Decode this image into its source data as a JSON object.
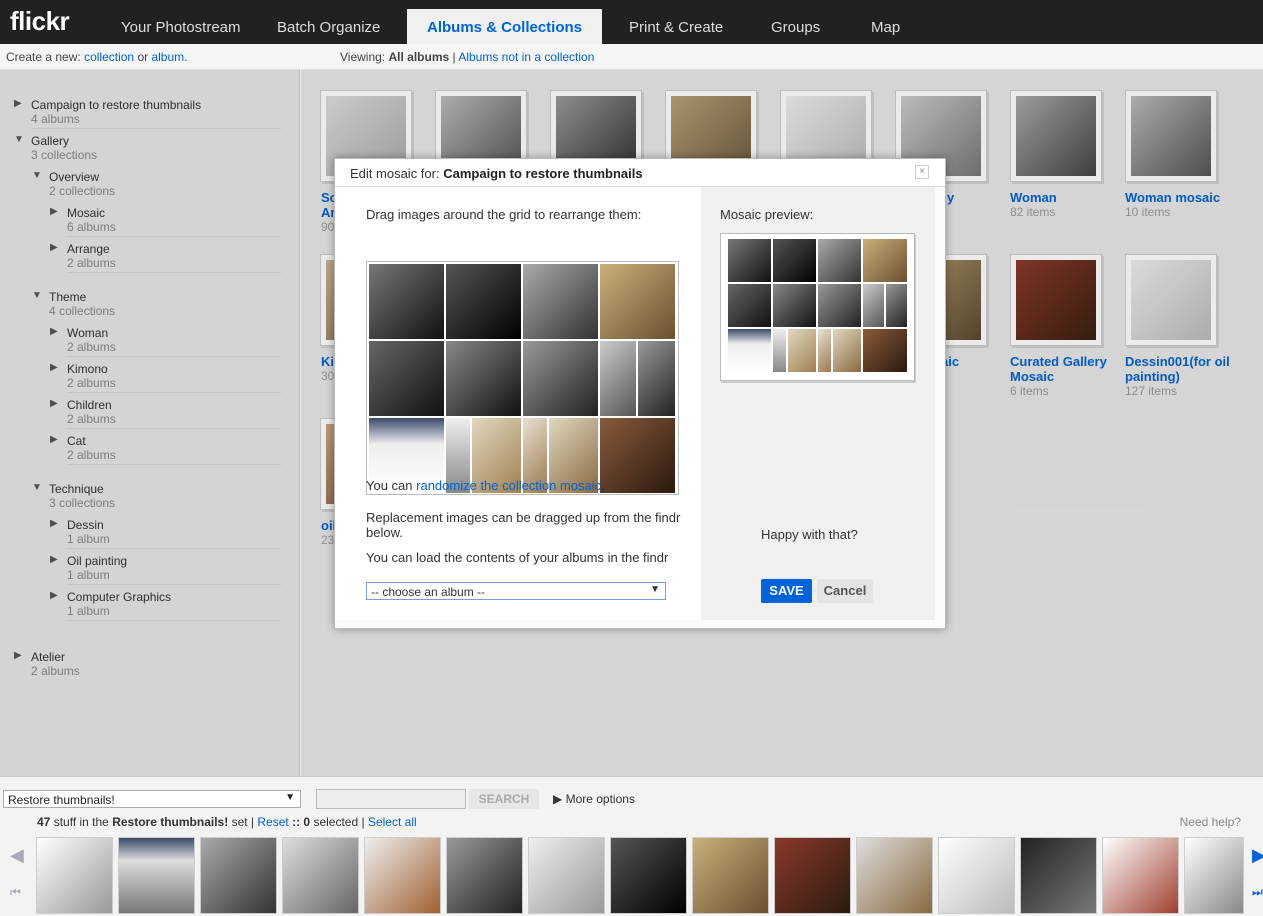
{
  "app": {
    "logo": "flickr",
    "nav": [
      "Your Photostream",
      "Batch Organize",
      "Albums & Collections",
      "Print & Create",
      "Groups",
      "Map"
    ],
    "active_nav": "Albums & Collections"
  },
  "subbar": {
    "create_prefix": "Create a new:",
    "collection_link": "collection",
    "or": "or",
    "album_link": "album",
    "period": ".",
    "viewing_prefix": "Viewing:",
    "viewing_current": "All albums",
    "separator": "|",
    "viewing_other": "Albums not in a collection"
  },
  "sidebar": {
    "items": [
      {
        "title": "Campaign to restore thumbnails",
        "sub": "4 albums",
        "expanded": false
      },
      {
        "title": "Gallery",
        "sub": "3 collections",
        "expanded": true
      },
      {
        "title": "Overview",
        "sub": "2 collections",
        "expanded": true
      },
      {
        "title": "Mosaic",
        "sub": "6 albums",
        "expanded": false
      },
      {
        "title": "Arrange",
        "sub": "2 albums",
        "expanded": false
      },
      {
        "title": "Theme",
        "sub": "4 collections",
        "expanded": true
      },
      {
        "title": "Woman",
        "sub": "2 albums",
        "expanded": false
      },
      {
        "title": "Kimono",
        "sub": "2 albums",
        "expanded": false
      },
      {
        "title": "Children",
        "sub": "2 albums",
        "expanded": false
      },
      {
        "title": "Cat",
        "sub": "2 albums",
        "expanded": false
      },
      {
        "title": "Technique",
        "sub": "3 collections",
        "expanded": true
      },
      {
        "title": "Dessin",
        "sub": "1 album",
        "expanded": false
      },
      {
        "title": "Oil painting",
        "sub": "1 album",
        "expanded": false
      },
      {
        "title": "Computer Graphics",
        "sub": "1 album",
        "expanded": false
      },
      {
        "title": "Atelier",
        "sub": "2 albums",
        "expanded": false
      }
    ]
  },
  "albums": {
    "visible_titles": [
      {
        "t1": "Sc",
        "t2": "Ar",
        "sub": "90"
      },
      {
        "t1": "y",
        "t2": "",
        "sub": ""
      },
      {
        "t1": "Woman",
        "t2": "",
        "sub": "82 items"
      },
      {
        "t1": "Woman mosaic",
        "t2": "",
        "sub": "10 items"
      },
      {
        "t1": "Ki",
        "t2": "",
        "sub": "30"
      },
      {
        "t1": "aic",
        "t2": "",
        "sub": ""
      },
      {
        "t1": "Curated Gallery",
        "t2": "Mosaic",
        "sub": "6 items"
      },
      {
        "t1": "Dessin001(for oil",
        "t2": "painting)",
        "sub": "127 items"
      },
      {
        "t1": "oil",
        "t2": "",
        "sub": "23"
      }
    ]
  },
  "modal": {
    "title_prefix": "Edit mosaic for:",
    "title_collection": "Campaign to restore thumbnails",
    "close": "×",
    "drag_instruction": "Drag images around the grid to rearrange them:",
    "preview_label": "Mosaic preview:",
    "randomize_prefix": "You can",
    "randomize_link": "randomize the collection mosaic",
    "randomize_suffix": ".",
    "replacement_text": "Replacement images can be dragged up from the findr below.",
    "load_text": "You can load the contents of your albums in the findr",
    "album_select": "-- choose an album --",
    "happy_text": "Happy with that?",
    "save_label": "SAVE",
    "cancel_label": "Cancel"
  },
  "findr": {
    "set_select": "Restore thumbnails!",
    "search_label": "SEARCH",
    "more_options": "More options",
    "status_count": "47",
    "status_mid": "stuff in the",
    "status_set": "Restore thumbnails!",
    "status_set_suffix": "set |",
    "reset_link": "Reset",
    "status_selected_sep": "::",
    "selected_count": "0",
    "selected_word": "selected |",
    "select_all_link": "Select all",
    "need_help": "Need help?"
  },
  "colors": {
    "brand_blue": "#0063dc",
    "nav_bg": "#212124"
  }
}
